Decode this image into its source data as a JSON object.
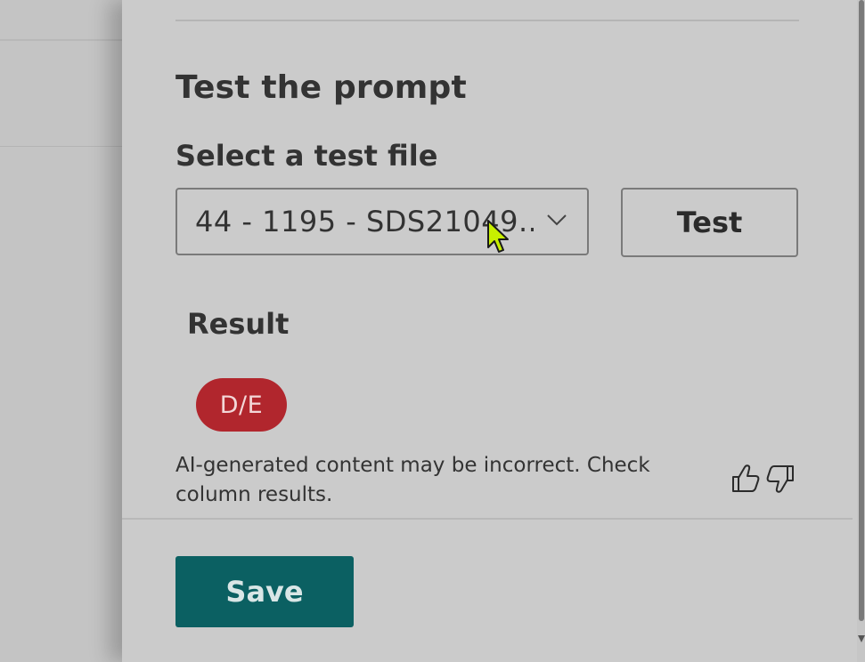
{
  "panel": {
    "section_title": "Test the prompt",
    "file_label": "Select a test file",
    "file_select": {
      "selected_value": "44 - 1195 - SDS21049...."
    },
    "test_label": "Test",
    "result_label": "Result",
    "result_value": "D/E",
    "result_badge_color": "#b1262d",
    "disclaimer": "AI-generated content may be incorrect. Check column results.",
    "save_label": "Save",
    "save_color": "#0b6062"
  },
  "icons": {
    "dropdown": "chevron-down-icon",
    "thumbs_up": "thumbs-up-icon",
    "thumbs_down": "thumbs-down-icon",
    "cursor": "mouse-cursor-icon"
  }
}
